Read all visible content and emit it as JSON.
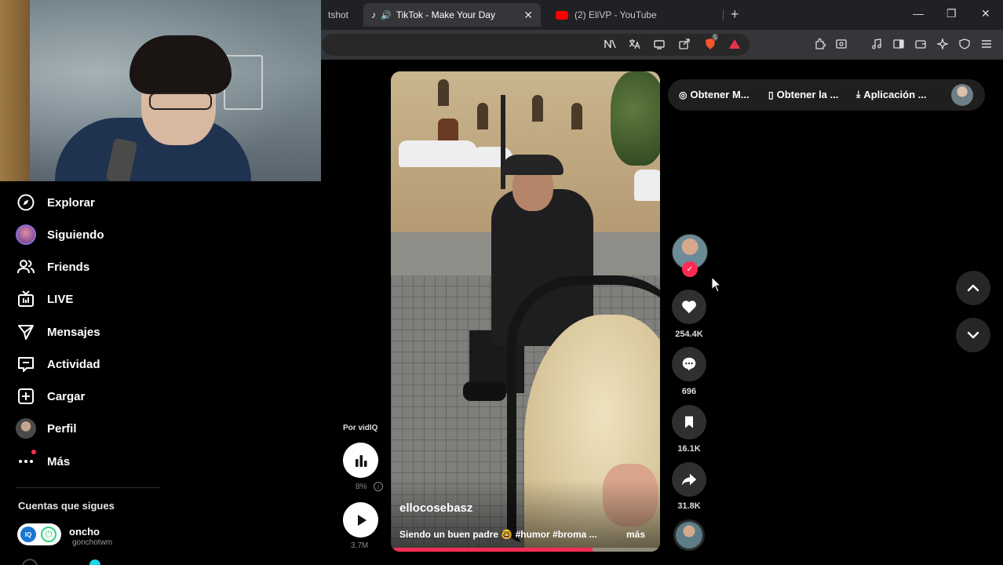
{
  "browser": {
    "tabs": [
      {
        "label": "tshot",
        "active": false
      },
      {
        "label": "TikTok - Make Your Day",
        "active": true
      },
      {
        "label": "(2) EliVP - YouTube",
        "active": false
      }
    ],
    "close_glyph": "✕",
    "new_tab_glyph": "+",
    "window_controls": {
      "minimize": "—",
      "restore": "❐",
      "close": "✕"
    },
    "brave_badge_count": "5"
  },
  "sidebar": {
    "items": [
      {
        "label": "Explorar",
        "icon": "compass-icon"
      },
      {
        "label": "Siguiendo",
        "icon": "following-avatar-icon"
      },
      {
        "label": "Friends",
        "icon": "friends-icon"
      },
      {
        "label": "LIVE",
        "icon": "live-tv-icon"
      },
      {
        "label": "Mensajes",
        "icon": "send-icon"
      },
      {
        "label": "Actividad",
        "icon": "activity-icon"
      },
      {
        "label": "Cargar",
        "icon": "upload-plus-icon"
      },
      {
        "label": "Perfil",
        "icon": "profile-avatar-icon"
      },
      {
        "label": "Más",
        "icon": "more-dots-icon"
      }
    ],
    "following_header": "Cuentas que sigues",
    "following": [
      {
        "name": "oncho",
        "handle": "gonchotwm"
      }
    ]
  },
  "vidiq": {
    "label": "Por vidIQ",
    "percent": "8%",
    "info": "i",
    "views": "3.7M"
  },
  "video": {
    "author": "ellocosebasz",
    "caption": "Siendo un buen padre 🤓 #humor #broma ...",
    "more": "más",
    "progress": 0.75
  },
  "actions": {
    "likes": "254.4K",
    "comments": "696",
    "saves": "16.1K",
    "shares": "31.8K",
    "check": "✓"
  },
  "top_pill": {
    "items": [
      {
        "label": "Obtener M...",
        "icon": "coin-icon"
      },
      {
        "label": "Obtener la ...",
        "icon": "phone-icon"
      },
      {
        "label": "Aplicación ...",
        "icon": "download-icon"
      }
    ]
  },
  "colors": {
    "accent": "#fe2c55",
    "background": "#000000",
    "chrome": "#35363a"
  }
}
